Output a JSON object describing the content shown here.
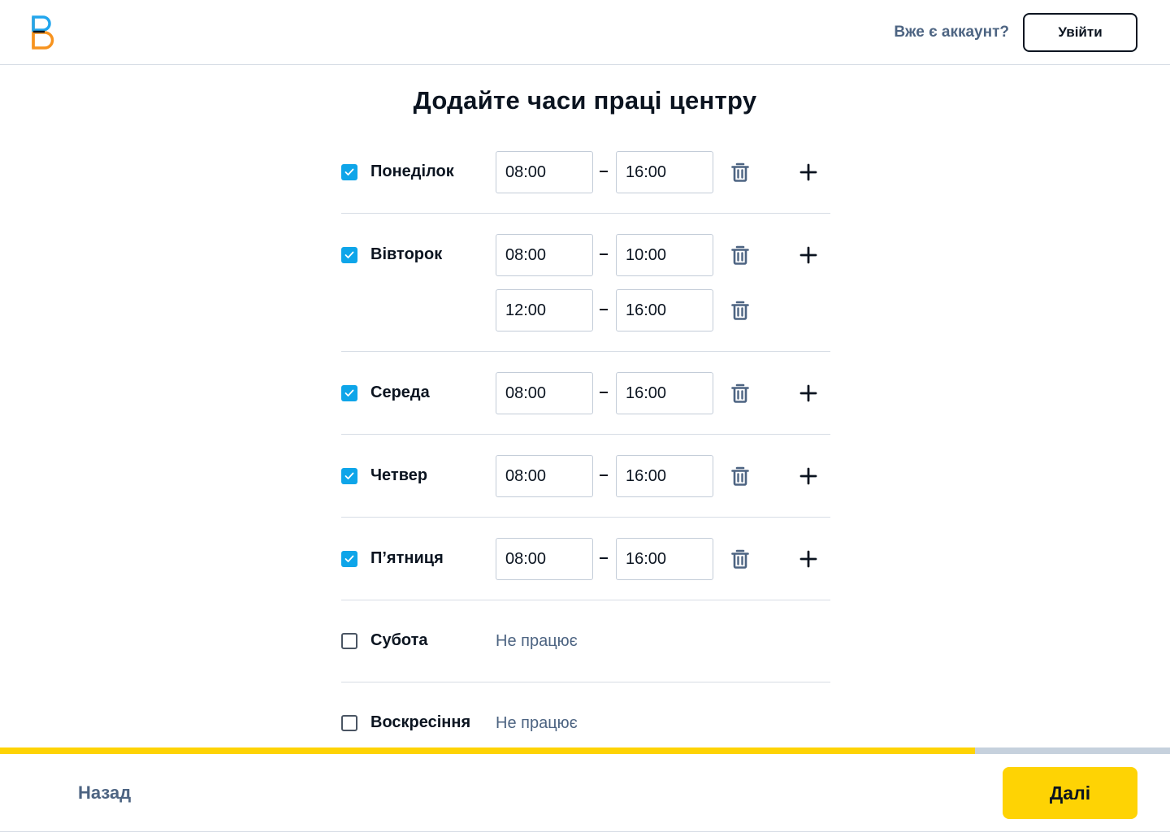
{
  "header": {
    "account_question": "Вже є аккаунт?",
    "login_label": "Увійти"
  },
  "title": "Додайте часи праці центру",
  "days": [
    {
      "name": "Понеділок",
      "enabled": true,
      "slots": [
        {
          "start": "08:00",
          "end": "16:00"
        }
      ]
    },
    {
      "name": "Вівторок",
      "enabled": true,
      "slots": [
        {
          "start": "08:00",
          "end": "10:00"
        },
        {
          "start": "12:00",
          "end": "16:00"
        }
      ]
    },
    {
      "name": "Середа",
      "enabled": true,
      "slots": [
        {
          "start": "08:00",
          "end": "16:00"
        }
      ]
    },
    {
      "name": "Четвер",
      "enabled": true,
      "slots": [
        {
          "start": "08:00",
          "end": "16:00"
        }
      ]
    },
    {
      "name": "П’ятниця",
      "enabled": true,
      "slots": [
        {
          "start": "08:00",
          "end": "16:00"
        }
      ]
    },
    {
      "name": "Субота",
      "enabled": false,
      "status": "Не працює"
    },
    {
      "name": "Воскресіння",
      "enabled": false,
      "status": "Не працює"
    }
  ],
  "progress": {
    "fraction": 0.833
  },
  "footer": {
    "back_label": "Назад",
    "next_label": "Далі"
  },
  "colors": {
    "accent_yellow": "#fed304",
    "checkbox_blue": "#0ea5e9",
    "muted_text": "#4d6482",
    "dark_text": "#0b1420",
    "divider": "#d7dde5"
  },
  "icons": {
    "logo": "brand-logo",
    "checkbox": "check-icon",
    "remove_slot": "trash-icon",
    "add_slot": "plus-icon"
  }
}
